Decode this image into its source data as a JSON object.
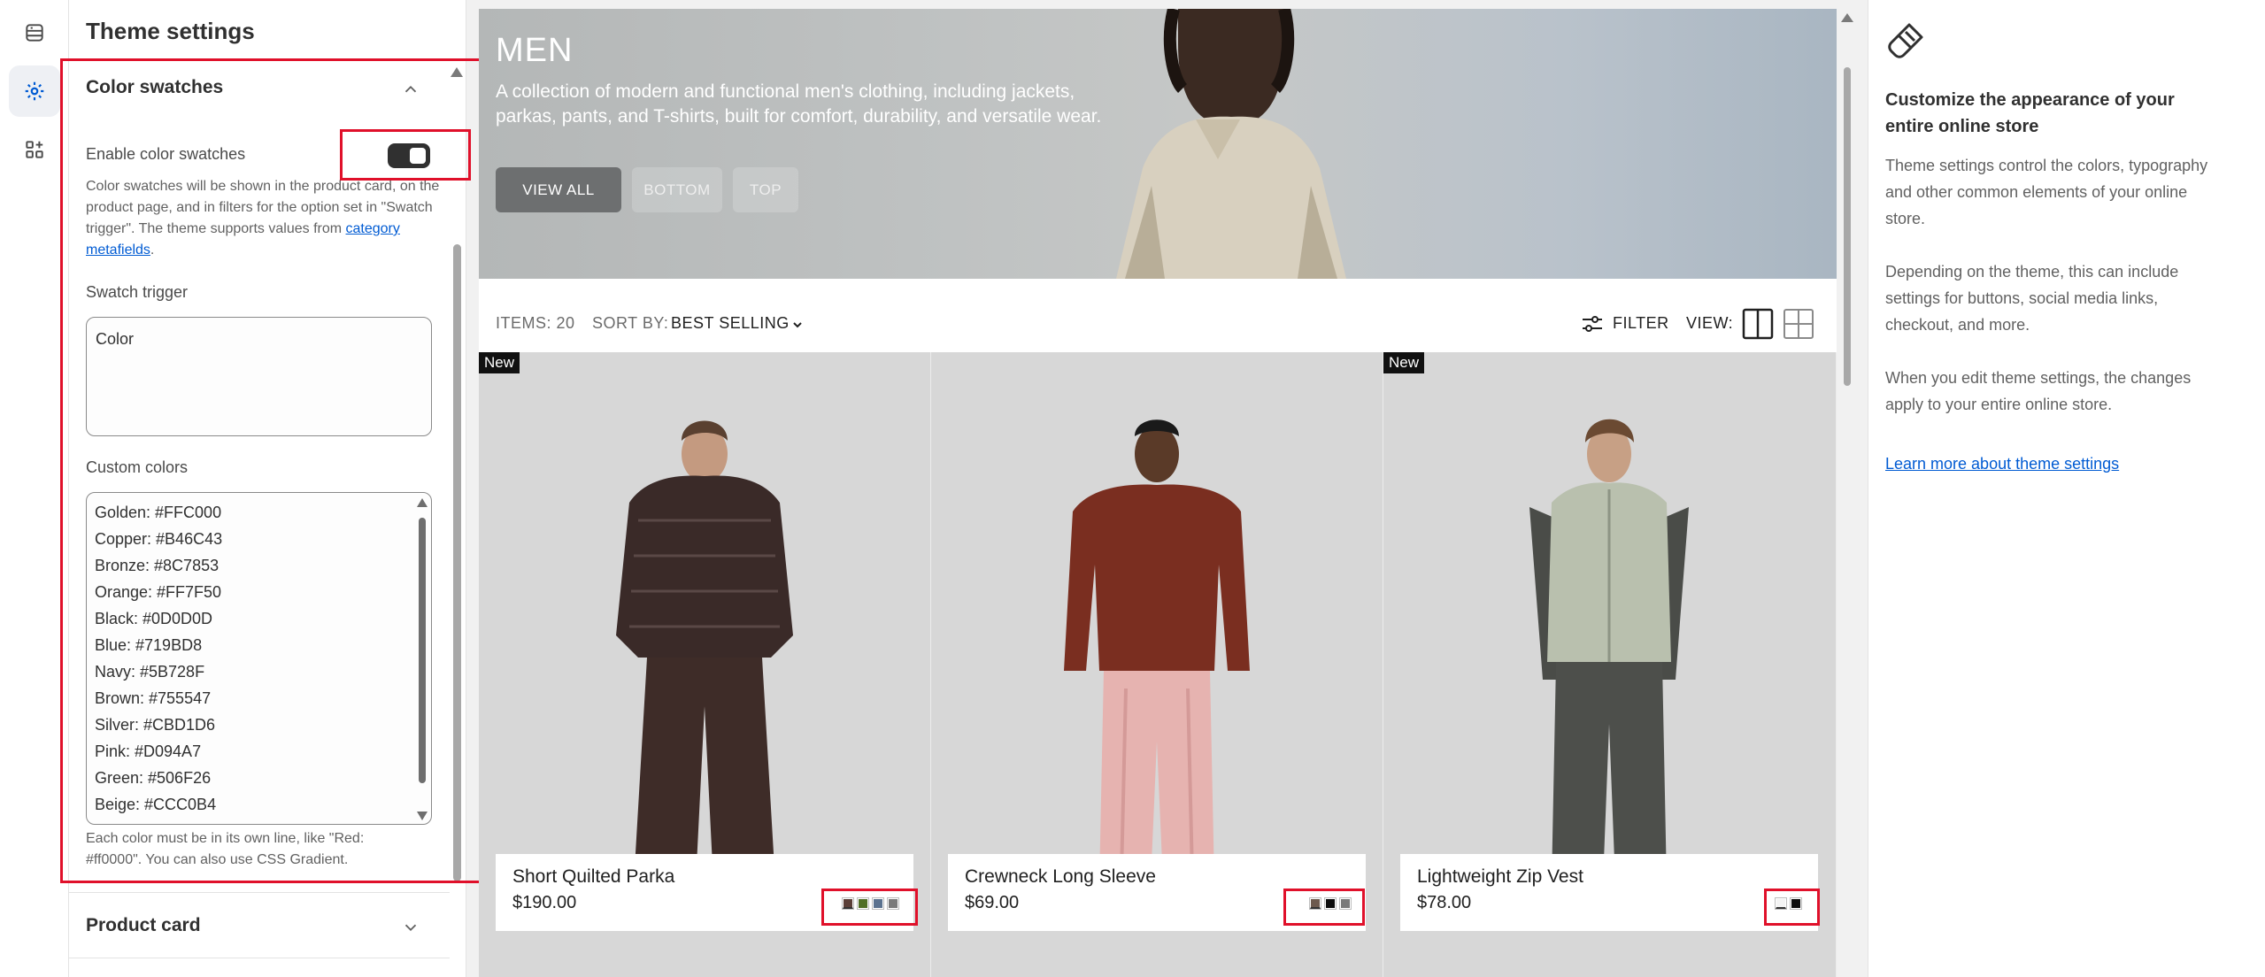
{
  "settings": {
    "title": "Theme settings",
    "section_color_swatches": "Color swatches",
    "enable_label": "Enable color swatches",
    "enable_help": "Color swatches will be shown in the product card, on the product page, and in filters for the option set in \"Swatch trigger\". The theme supports values from ",
    "enable_help_link": "category metafields",
    "enable_help_end": ".",
    "enable_value": true,
    "swatch_trigger_label": "Swatch trigger",
    "swatch_trigger_value": "Color",
    "custom_colors_label": "Custom colors",
    "custom_colors": [
      "Golden: #FFC000",
      "Copper: #B46C43",
      "Bronze: #8C7853",
      "Orange: #FF7F50",
      "Black: #0D0D0D",
      "Blue: #719BD8",
      "Navy: #5B728F",
      "Brown: #755547",
      "Silver: #CBD1D6",
      "Pink: #D094A7",
      "Green: #506F26",
      "Beige: #CCC0B4"
    ],
    "custom_colors_help": "Each color must be in its own line, like \"Red: #ff0000\". You can also use CSS Gradient.",
    "section_product_card": "Product card"
  },
  "preview": {
    "hero_title": "MEN",
    "hero_desc": "A collection of modern and functional men's clothing, including jackets, parkas, pants, and T-shirts, built for comfort, durability, and versatile wear.",
    "btn_view_all": "VIEW ALL",
    "btn_bottom": "BOTTOM",
    "btn_top": "TOP",
    "items_label": "ITEMS: 20",
    "sort_label": "SORT BY:",
    "sort_value": "BEST SELLING",
    "filter_label": "FILTER",
    "view_label": "VIEW:",
    "products": [
      {
        "badge": "New",
        "name": "Short Quilted Parka",
        "price": "$190.00",
        "swatches": [
          "#5b3f38",
          "#506f26",
          "#5b728f",
          "#7a7a7a"
        ]
      },
      {
        "badge": "",
        "name": "Crewneck Long Sleeve",
        "price": "$69.00",
        "swatches": [
          "#6d5a4e",
          "#0d0d0d",
          "#7a7a7a"
        ]
      },
      {
        "badge": "New",
        "name": "Lightweight Zip Vest",
        "price": "$78.00",
        "swatches": [
          "#f4f4f4",
          "#0d0d0d"
        ]
      }
    ]
  },
  "info": {
    "heading": "Customize the appearance of your entire online store",
    "p1": "Theme settings control the colors, typography and other common elements of your online store.",
    "p2": "Depending on the theme, this can include settings for buttons, social media links, checkout, and more.",
    "p3": "When you edit theme settings, the changes apply to your entire online store.",
    "link": "Learn more about theme settings"
  }
}
